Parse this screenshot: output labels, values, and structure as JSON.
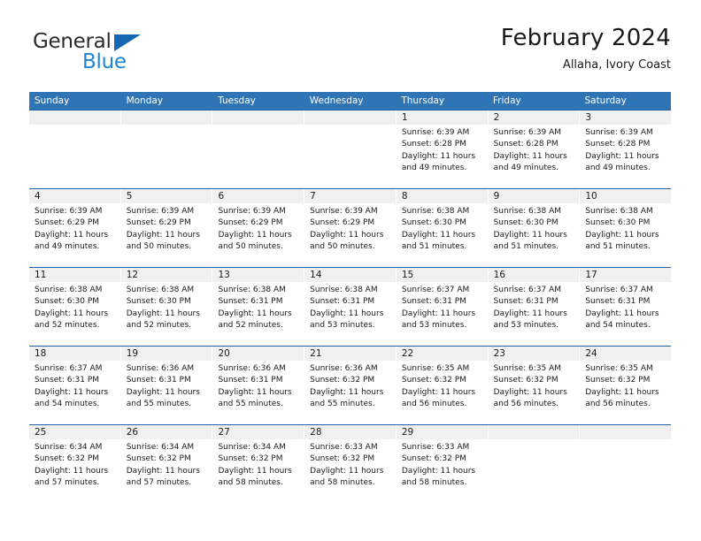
{
  "brand": {
    "name_part1": "General",
    "name_part2": "Blue",
    "triangle_color": "#1667b1",
    "blue_color": "#1e84d4"
  },
  "header": {
    "title": "February 2024",
    "subtitle": "Allaha, Ivory Coast"
  },
  "colors": {
    "header_blue": "#2f75b5",
    "week_divider": "#1f61a8",
    "daynum_band": "#f0f0f0"
  },
  "weekdays": [
    "Sunday",
    "Monday",
    "Tuesday",
    "Wednesday",
    "Thursday",
    "Friday",
    "Saturday"
  ],
  "weeks": [
    [
      {
        "day": "",
        "sunrise": "",
        "sunset": "",
        "daylight_line1": "",
        "daylight_line2": ""
      },
      {
        "day": "",
        "sunrise": "",
        "sunset": "",
        "daylight_line1": "",
        "daylight_line2": ""
      },
      {
        "day": "",
        "sunrise": "",
        "sunset": "",
        "daylight_line1": "",
        "daylight_line2": ""
      },
      {
        "day": "",
        "sunrise": "",
        "sunset": "",
        "daylight_line1": "",
        "daylight_line2": ""
      },
      {
        "day": "1",
        "sunrise": "Sunrise: 6:39 AM",
        "sunset": "Sunset: 6:28 PM",
        "daylight_line1": "Daylight: 11 hours",
        "daylight_line2": "and 49 minutes."
      },
      {
        "day": "2",
        "sunrise": "Sunrise: 6:39 AM",
        "sunset": "Sunset: 6:28 PM",
        "daylight_line1": "Daylight: 11 hours",
        "daylight_line2": "and 49 minutes."
      },
      {
        "day": "3",
        "sunrise": "Sunrise: 6:39 AM",
        "sunset": "Sunset: 6:28 PM",
        "daylight_line1": "Daylight: 11 hours",
        "daylight_line2": "and 49 minutes."
      }
    ],
    [
      {
        "day": "4",
        "sunrise": "Sunrise: 6:39 AM",
        "sunset": "Sunset: 6:29 PM",
        "daylight_line1": "Daylight: 11 hours",
        "daylight_line2": "and 49 minutes."
      },
      {
        "day": "5",
        "sunrise": "Sunrise: 6:39 AM",
        "sunset": "Sunset: 6:29 PM",
        "daylight_line1": "Daylight: 11 hours",
        "daylight_line2": "and 50 minutes."
      },
      {
        "day": "6",
        "sunrise": "Sunrise: 6:39 AM",
        "sunset": "Sunset: 6:29 PM",
        "daylight_line1": "Daylight: 11 hours",
        "daylight_line2": "and 50 minutes."
      },
      {
        "day": "7",
        "sunrise": "Sunrise: 6:39 AM",
        "sunset": "Sunset: 6:29 PM",
        "daylight_line1": "Daylight: 11 hours",
        "daylight_line2": "and 50 minutes."
      },
      {
        "day": "8",
        "sunrise": "Sunrise: 6:38 AM",
        "sunset": "Sunset: 6:30 PM",
        "daylight_line1": "Daylight: 11 hours",
        "daylight_line2": "and 51 minutes."
      },
      {
        "day": "9",
        "sunrise": "Sunrise: 6:38 AM",
        "sunset": "Sunset: 6:30 PM",
        "daylight_line1": "Daylight: 11 hours",
        "daylight_line2": "and 51 minutes."
      },
      {
        "day": "10",
        "sunrise": "Sunrise: 6:38 AM",
        "sunset": "Sunset: 6:30 PM",
        "daylight_line1": "Daylight: 11 hours",
        "daylight_line2": "and 51 minutes."
      }
    ],
    [
      {
        "day": "11",
        "sunrise": "Sunrise: 6:38 AM",
        "sunset": "Sunset: 6:30 PM",
        "daylight_line1": "Daylight: 11 hours",
        "daylight_line2": "and 52 minutes."
      },
      {
        "day": "12",
        "sunrise": "Sunrise: 6:38 AM",
        "sunset": "Sunset: 6:30 PM",
        "daylight_line1": "Daylight: 11 hours",
        "daylight_line2": "and 52 minutes."
      },
      {
        "day": "13",
        "sunrise": "Sunrise: 6:38 AM",
        "sunset": "Sunset: 6:31 PM",
        "daylight_line1": "Daylight: 11 hours",
        "daylight_line2": "and 52 minutes."
      },
      {
        "day": "14",
        "sunrise": "Sunrise: 6:38 AM",
        "sunset": "Sunset: 6:31 PM",
        "daylight_line1": "Daylight: 11 hours",
        "daylight_line2": "and 53 minutes."
      },
      {
        "day": "15",
        "sunrise": "Sunrise: 6:37 AM",
        "sunset": "Sunset: 6:31 PM",
        "daylight_line1": "Daylight: 11 hours",
        "daylight_line2": "and 53 minutes."
      },
      {
        "day": "16",
        "sunrise": "Sunrise: 6:37 AM",
        "sunset": "Sunset: 6:31 PM",
        "daylight_line1": "Daylight: 11 hours",
        "daylight_line2": "and 53 minutes."
      },
      {
        "day": "17",
        "sunrise": "Sunrise: 6:37 AM",
        "sunset": "Sunset: 6:31 PM",
        "daylight_line1": "Daylight: 11 hours",
        "daylight_line2": "and 54 minutes."
      }
    ],
    [
      {
        "day": "18",
        "sunrise": "Sunrise: 6:37 AM",
        "sunset": "Sunset: 6:31 PM",
        "daylight_line1": "Daylight: 11 hours",
        "daylight_line2": "and 54 minutes."
      },
      {
        "day": "19",
        "sunrise": "Sunrise: 6:36 AM",
        "sunset": "Sunset: 6:31 PM",
        "daylight_line1": "Daylight: 11 hours",
        "daylight_line2": "and 55 minutes."
      },
      {
        "day": "20",
        "sunrise": "Sunrise: 6:36 AM",
        "sunset": "Sunset: 6:31 PM",
        "daylight_line1": "Daylight: 11 hours",
        "daylight_line2": "and 55 minutes."
      },
      {
        "day": "21",
        "sunrise": "Sunrise: 6:36 AM",
        "sunset": "Sunset: 6:32 PM",
        "daylight_line1": "Daylight: 11 hours",
        "daylight_line2": "and 55 minutes."
      },
      {
        "day": "22",
        "sunrise": "Sunrise: 6:35 AM",
        "sunset": "Sunset: 6:32 PM",
        "daylight_line1": "Daylight: 11 hours",
        "daylight_line2": "and 56 minutes."
      },
      {
        "day": "23",
        "sunrise": "Sunrise: 6:35 AM",
        "sunset": "Sunset: 6:32 PM",
        "daylight_line1": "Daylight: 11 hours",
        "daylight_line2": "and 56 minutes."
      },
      {
        "day": "24",
        "sunrise": "Sunrise: 6:35 AM",
        "sunset": "Sunset: 6:32 PM",
        "daylight_line1": "Daylight: 11 hours",
        "daylight_line2": "and 56 minutes."
      }
    ],
    [
      {
        "day": "25",
        "sunrise": "Sunrise: 6:34 AM",
        "sunset": "Sunset: 6:32 PM",
        "daylight_line1": "Daylight: 11 hours",
        "daylight_line2": "and 57 minutes."
      },
      {
        "day": "26",
        "sunrise": "Sunrise: 6:34 AM",
        "sunset": "Sunset: 6:32 PM",
        "daylight_line1": "Daylight: 11 hours",
        "daylight_line2": "and 57 minutes."
      },
      {
        "day": "27",
        "sunrise": "Sunrise: 6:34 AM",
        "sunset": "Sunset: 6:32 PM",
        "daylight_line1": "Daylight: 11 hours",
        "daylight_line2": "and 58 minutes."
      },
      {
        "day": "28",
        "sunrise": "Sunrise: 6:33 AM",
        "sunset": "Sunset: 6:32 PM",
        "daylight_line1": "Daylight: 11 hours",
        "daylight_line2": "and 58 minutes."
      },
      {
        "day": "29",
        "sunrise": "Sunrise: 6:33 AM",
        "sunset": "Sunset: 6:32 PM",
        "daylight_line1": "Daylight: 11 hours",
        "daylight_line2": "and 58 minutes."
      },
      {
        "day": "",
        "sunrise": "",
        "sunset": "",
        "daylight_line1": "",
        "daylight_line2": ""
      },
      {
        "day": "",
        "sunrise": "",
        "sunset": "",
        "daylight_line1": "",
        "daylight_line2": ""
      }
    ]
  ]
}
